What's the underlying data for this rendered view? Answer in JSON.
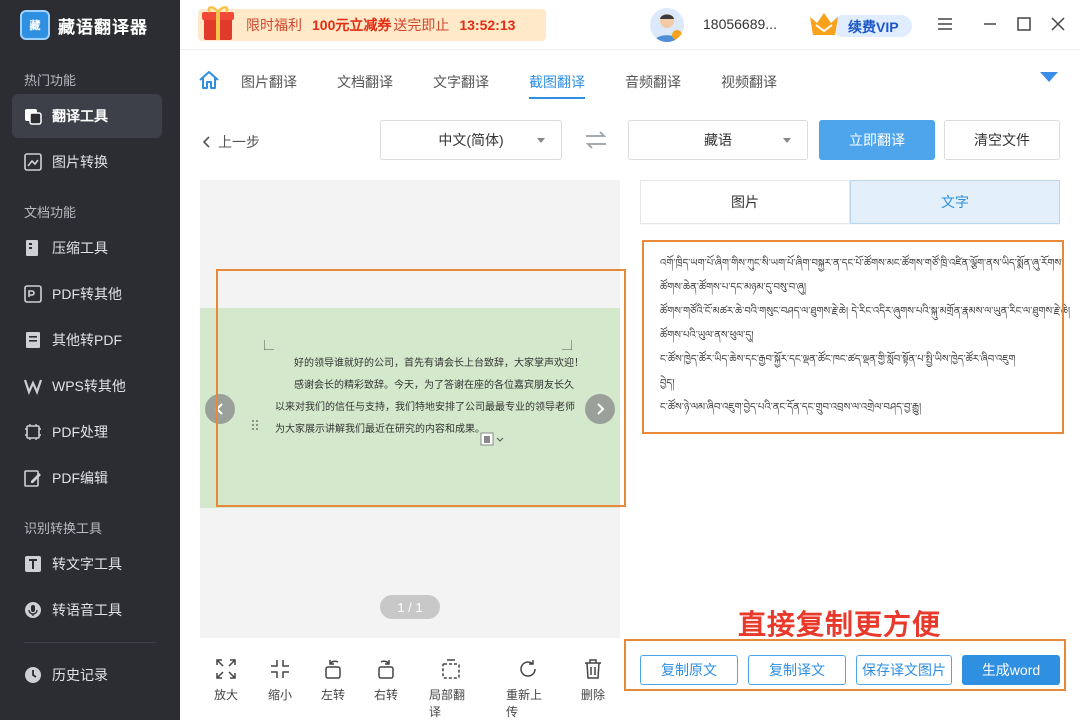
{
  "app": {
    "name": "藏语翻译器",
    "logo_text": "藏"
  },
  "sidebar": {
    "sections": [
      {
        "title": "热门功能"
      },
      {
        "title": "文档功能"
      },
      {
        "title": "识别转换工具"
      }
    ],
    "items": [
      {
        "label": "翻译工具",
        "icon": "translate-tool-icon"
      },
      {
        "label": "图片转换",
        "icon": "image-convert-icon"
      },
      {
        "label": "压缩工具",
        "icon": "compress-icon"
      },
      {
        "label": "PDF转其他",
        "icon": "pdf-convert-icon"
      },
      {
        "label": "其他转PDF",
        "icon": "to-pdf-icon"
      },
      {
        "label": "WPS转其他",
        "icon": "wps-icon"
      },
      {
        "label": "PDF处理",
        "icon": "pdf-process-icon"
      },
      {
        "label": "PDF编辑",
        "icon": "pdf-edit-icon"
      },
      {
        "label": "转文字工具",
        "icon": "text-tool-icon"
      },
      {
        "label": "转语音工具",
        "icon": "voice-tool-icon"
      },
      {
        "label": "历史记录",
        "icon": "history-icon"
      }
    ]
  },
  "topbar": {
    "promo_label": "限时福利",
    "promo_coupon": "100元立减券",
    "promo_suffix": "送完即止",
    "promo_timer": "13:52:13",
    "phone": "18056689...",
    "vip_label": "续费VIP"
  },
  "nav": {
    "tabs": [
      "图片翻译",
      "文档翻译",
      "文字翻译",
      "截图翻译",
      "音频翻译",
      "视频翻译"
    ],
    "active": "截图翻译"
  },
  "toolbar": {
    "back_label": "上一步",
    "source_lang": "中文(简体)",
    "target_lang": "藏语",
    "translate_label": "立即翻译",
    "clear_label": "清空文件"
  },
  "image": {
    "lines": [
      "好的领导谁就好的公司，首先有请会长上台致辞，大家掌声欢迎！",
      "感谢会长的精彩致辞。今天，为了答谢在座的各位嘉宾朋友长久",
      "以来对我们的信任与支持，我们特地安排了公司最最专业的领导老师",
      "为大家展示讲解我们最近在研究的内容和成果。"
    ],
    "page_counter": "1 / 1"
  },
  "tools": [
    "放大",
    "缩小",
    "左转",
    "右转",
    "局部翻译",
    "重新上传",
    "删除"
  ],
  "result": {
    "tab_image": "图片",
    "tab_text": "文字",
    "lines": [
      "འགོ་ཁྲིད་ཡག་པོ་ཞིག་གིས་ཀུང་སི་ཡག་པོ་ཞིག་བསྐྱར་ན་དང་པོ་ཚོགས་མང་ཚོགས་གཙོ་ཁྲི་འཛིན་ལྕོག་ནས་ཡིད་སྨོན་ཞུ་རོགས།",
      "ཚོགས་ཆེན་ཚོགས་པ་དང་མཉམ་དུ་བསུ་བ་ཞུ།",
      "ཚོགས་གཙོའི་ངོ་མཚར་ཆེ་བའི་གསུང་བཤད་ལ་ཐུགས་རྗེ་ཆེ།  དེ་རིང་འདིར་ཞུགས་པའི་སྐུ་མགྲོན་རྣམས་ལ་ཡུན་རིང་ལ་ཐུགས་རྗེ་ཆེ།",
      "ཚོགས་པའི་ཡུལ་ནས་ཕུལ་དུ།",
      "ང་ཚོས་ཁྱེད་ཚོར་ཡིད་ཆེས་དང་རྒྱབ་སྐྱོར་དང་ལྡན་ཚོང་ཁང་ཚད་ལྡན་གྱི་སློབ་སྟོན་པ་སྤྱི་ཡིས་ཁྱེད་ཚོར་ཞིབ་འཇུག",
      "བྱེད།",
      "ང་ཚོས་ཉེ་ལམ་ཞིབ་འཇུག་བྱེད་པའི་ནང་དོན་དང་གྲུབ་འབྲས་ལ་འགྲེལ་བཤད་བྱ་རྒྱུ།"
    ],
    "slogan": "直接复制更方便",
    "copy_source": "复制原文",
    "copy_translation": "复制译文",
    "save_image": "保存译文图片",
    "generate_word": "生成word"
  },
  "colors": {
    "accent": "#2f8fe0",
    "sidebar_bg": "#2b2d33",
    "highlight": "#e8893a",
    "slogan": "#e8392a"
  }
}
